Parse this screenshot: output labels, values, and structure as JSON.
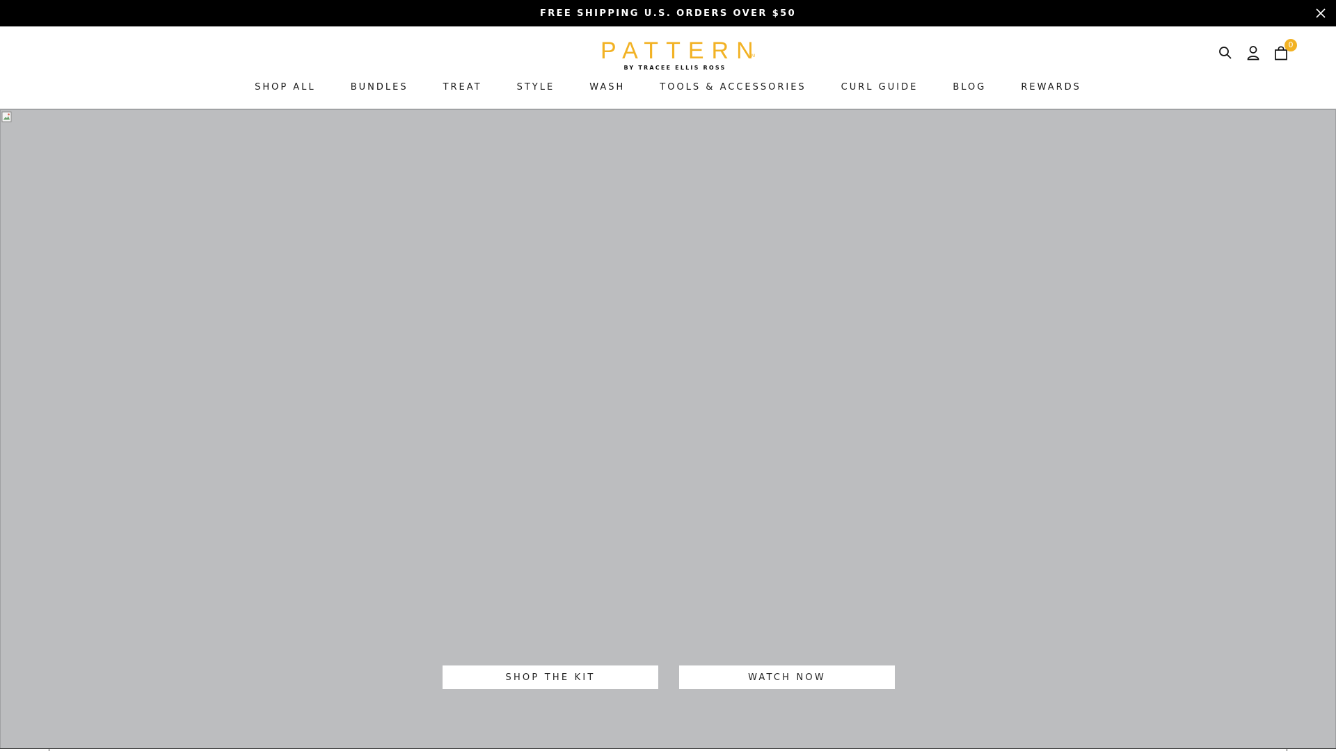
{
  "announcement": {
    "text": "FREE SHIPPING U.S. ORDERS OVER $50",
    "close_icon": "close-icon"
  },
  "header": {
    "logo": {
      "word": "PATTERN",
      "tagline": "BY TRACEE ELLIS ROSS",
      "trademark": "TM"
    },
    "icons": [
      "search-icon",
      "account-icon",
      "cart-icon"
    ],
    "cart_count": "0"
  },
  "nav": {
    "items": [
      {
        "label": "SHOP ALL"
      },
      {
        "label": "BUNDLES"
      },
      {
        "label": "TREAT"
      },
      {
        "label": "STYLE"
      },
      {
        "label": "WASH"
      },
      {
        "label": "TOOLS & ACCESSORIES"
      },
      {
        "label": "CURL GUIDE"
      },
      {
        "label": "BLOG"
      },
      {
        "label": "REWARDS"
      }
    ]
  },
  "hero": {
    "shop_label": "SHOP THE KIT",
    "watch_label": "WATCH NOW"
  },
  "colors": {
    "accent": "#f2b224",
    "announcement_bg": "#000000",
    "hero_bg": "#bcbdbf"
  }
}
